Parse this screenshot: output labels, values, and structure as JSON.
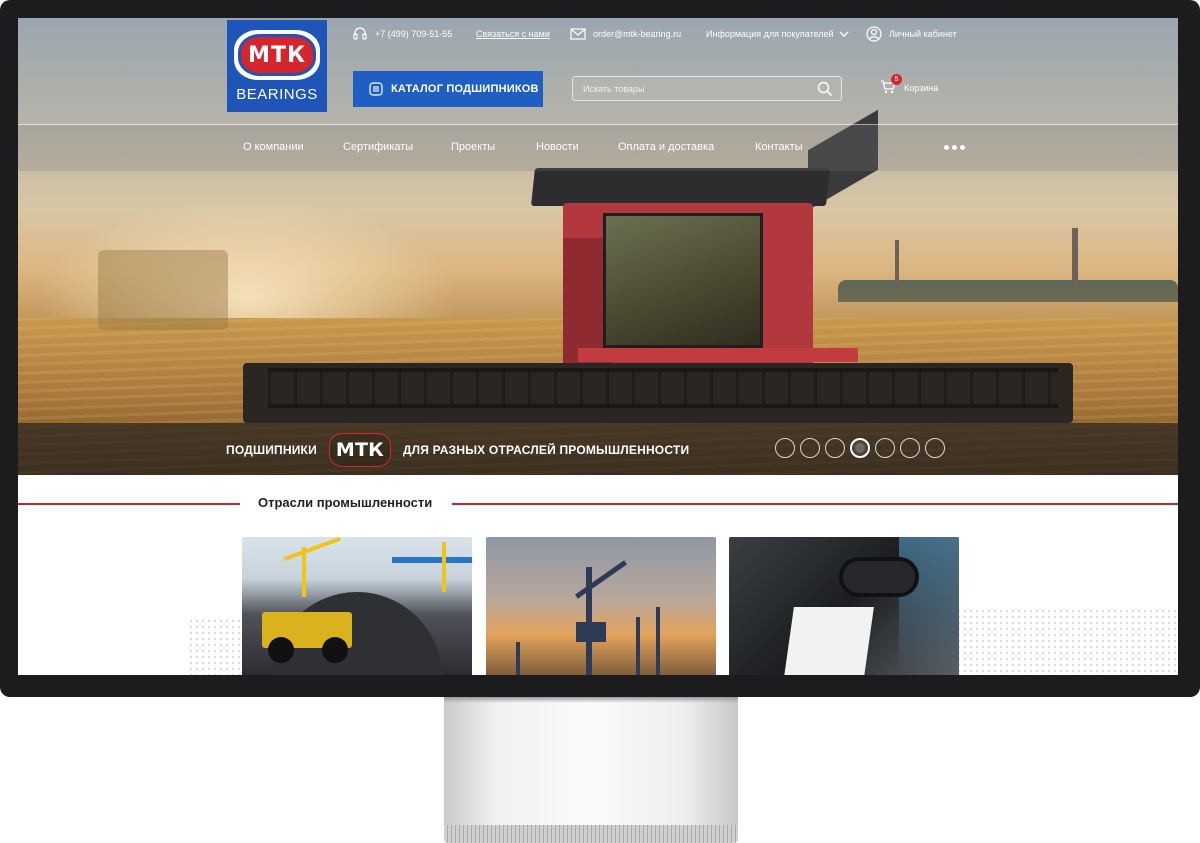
{
  "header": {
    "logo_text": "МТК",
    "logo_sub": "BEARINGS",
    "phone": "+7 (499) 709-51-55",
    "contact_link": "Связаться с нами",
    "email": "order@mtk-bearing.ru",
    "info_menu": "Информация для покупателей",
    "account": "Личный кабинет",
    "catalog_button": "КАТАЛОГ ПОДШИПНИКОВ",
    "search_placeholder": "Искать товары",
    "cart_label": "Корзина",
    "cart_count": "5"
  },
  "nav": {
    "items": [
      "О компании",
      "Сертификаты",
      "Проекты",
      "Новости",
      "Оплата и доставка",
      "Контакты"
    ]
  },
  "hero": {
    "caption_before": "ПОДШИПНИКИ",
    "caption_logo": "МТК",
    "caption_after": "ДЛЯ РАЗНЫХ ОТРАСЛЕЙ ПРОМЫШЛЕННОСТИ",
    "slide_count": 7,
    "active_slide": 4
  },
  "industries": {
    "title": "Отрасли промышленности"
  },
  "colors": {
    "brand_blue": "#1f55b8",
    "brand_red": "#d5262e",
    "accent_button": "#1f5fc4"
  },
  "icons": {
    "phone": "headset-icon",
    "mail": "envelope-icon",
    "info": "chevron-down-icon",
    "account": "user-circle-icon",
    "catalog": "list-icon",
    "search": "search-icon",
    "cart": "cart-icon",
    "more": "dots-icon"
  }
}
